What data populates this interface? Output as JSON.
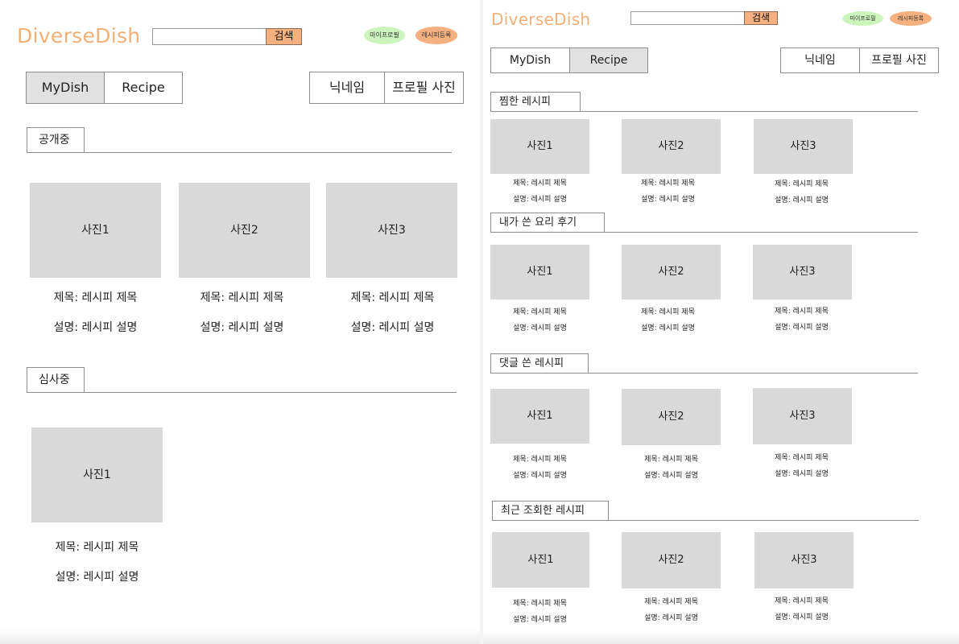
{
  "app": {
    "logo": "DiverseDish",
    "search_placeholder": "",
    "search_button": "검색",
    "my_profile": "마이프로필",
    "register_recipe": "레시피등록"
  },
  "tabs": {
    "mydish": "MyDish",
    "recipe": "Recipe"
  },
  "profile": {
    "nickname": "닉네임",
    "photo": "프로필 사진"
  },
  "left_screen": {
    "active_tab": "MyDish",
    "sections": [
      {
        "title": "공개중",
        "cards": [
          {
            "photo": "사진1",
            "title": "제목: 레시피 제목",
            "desc": "설명: 레시피 설명"
          },
          {
            "photo": "사진2",
            "title": "제목: 레시피 제목",
            "desc": "설명: 레시피 설명"
          },
          {
            "photo": "사진3",
            "title": "제목: 레시피 제목",
            "desc": "설명: 레시피 설명"
          }
        ]
      },
      {
        "title": "심사중",
        "cards": [
          {
            "photo": "사진1",
            "title": "제목: 레시피 제목",
            "desc": "설명: 레시피 설명"
          }
        ]
      }
    ]
  },
  "right_screen": {
    "active_tab": "Recipe",
    "sections": [
      {
        "title": "찜한 레시피",
        "cards": [
          {
            "photo": "사진1",
            "title": "제목: 레시피 제목",
            "desc": "설명: 레시피 설명"
          },
          {
            "photo": "사진2",
            "title": "제목: 레시피 제목",
            "desc": "설명: 레시피 설명"
          },
          {
            "photo": "사진3",
            "title": "제목: 레시피 제목",
            "desc": "설명: 레시피 설명"
          }
        ]
      },
      {
        "title": "내가 쓴 요리 후기",
        "cards": [
          {
            "photo": "사진1",
            "title": "제목: 레시피 제목",
            "desc": "설명: 레시피 설명"
          },
          {
            "photo": "사진2",
            "title": "제목: 레시피 제목",
            "desc": "설명: 레시피 설명"
          },
          {
            "photo": "사진3",
            "title": "제목: 레시피 제목",
            "desc": "설명: 레시피 설명"
          }
        ]
      },
      {
        "title": "댓글 쓴 레시피",
        "cards": [
          {
            "photo": "사진1",
            "title": "제목: 레시피 제목",
            "desc": "설명: 레시피 설명"
          },
          {
            "photo": "사진2",
            "title": "제목: 레시피 제목",
            "desc": "설명: 레시피 설명"
          },
          {
            "photo": "사진3",
            "title": "제목: 레시피 제목",
            "desc": "설명: 레시피 설명"
          }
        ]
      },
      {
        "title": "최근 조회한 레시피",
        "cards": [
          {
            "photo": "사진1",
            "title": "제목: 레시피 제목",
            "desc": "설명: 레시피 설명"
          },
          {
            "photo": "사진2",
            "title": "제목: 레시피 제목",
            "desc": "설명: 레시피 설명"
          },
          {
            "photo": "사진3",
            "title": "제목: 레시피 제목",
            "desc": "설명: 레시피 설명"
          }
        ]
      }
    ]
  },
  "colors": {
    "logo": "#f2b077",
    "search_button": "#f4b07f",
    "my_profile_pill": "#ccf5bd",
    "register_pill": "#f4b07f",
    "photo_placeholder": "#d9d9d9",
    "active_tab": "#e1e1e1"
  }
}
